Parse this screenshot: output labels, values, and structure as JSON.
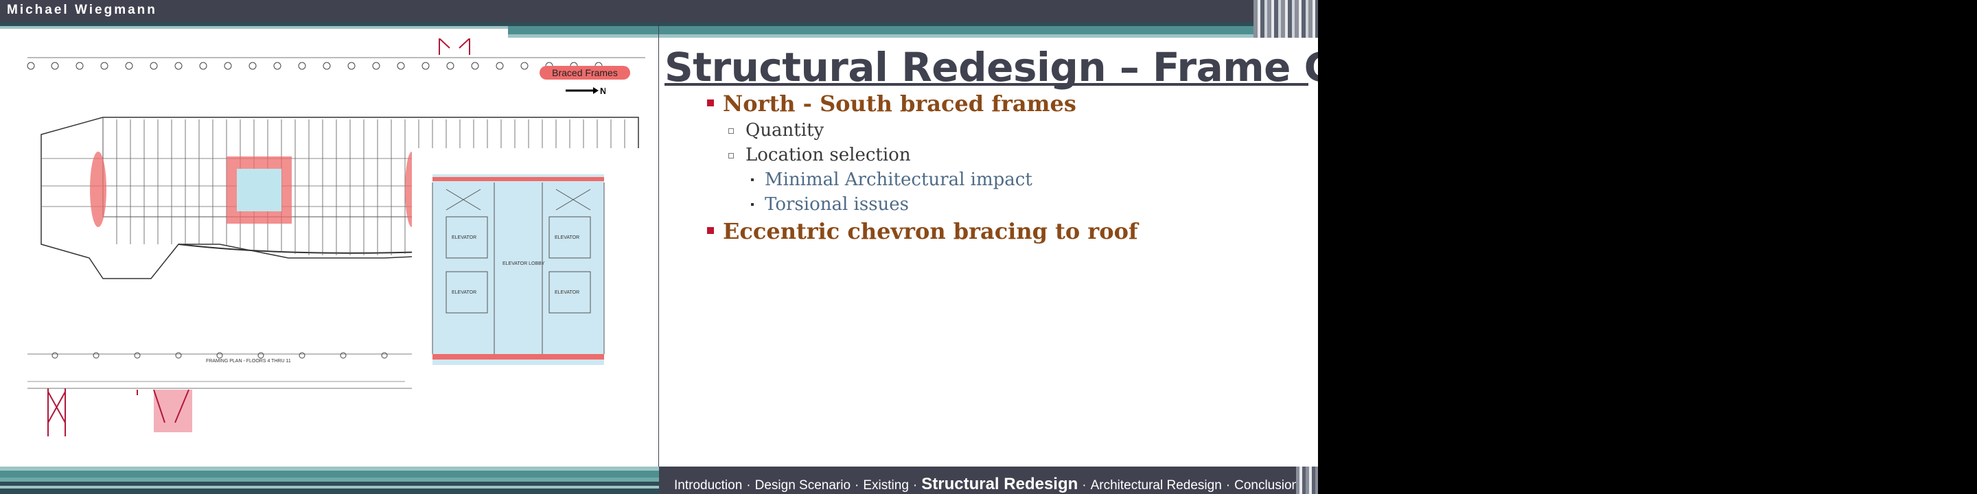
{
  "header": {
    "author": "Michael Wiegmann"
  },
  "slide": {
    "title": "Structural Redesign – Frame Geometry",
    "bullets": [
      {
        "text": "North - South braced frames",
        "level": 1
      },
      {
        "text": "Quantity",
        "level": 2
      },
      {
        "text": "Location selection",
        "level": 2
      },
      {
        "text": "Minimal Architectural impact",
        "level": 3
      },
      {
        "text": "Torsional issues",
        "level": 3
      },
      {
        "text": "Eccentric chevron bracing to roof",
        "level": 1
      }
    ]
  },
  "figure": {
    "legend_label": "Braced Frames",
    "north_label": "N",
    "plan_caption": "FRAMING PLAN - FLOORS 4 THRU 11",
    "core_labels": {
      "elevator": "ELEVATOR",
      "lobby": "ELEVATOR LOBBY"
    }
  },
  "footer": {
    "nav": {
      "introduction": "Introduction",
      "design_scenario": "Design Scenario",
      "existing": "Existing",
      "structural_redesign": "Structural Redesign",
      "architectural_redesign": "Architectural Redesign",
      "conclusions": "Conclusions"
    },
    "separator": "·"
  },
  "colors": {
    "header": "#40424f",
    "teal": "#4f8f91",
    "accent_red": "#ee6b6b",
    "title": "#40424f",
    "bullet_level1": "#8b4a17",
    "bullet_level3": "#4f6b86",
    "core_fill": "#cde8f2"
  }
}
